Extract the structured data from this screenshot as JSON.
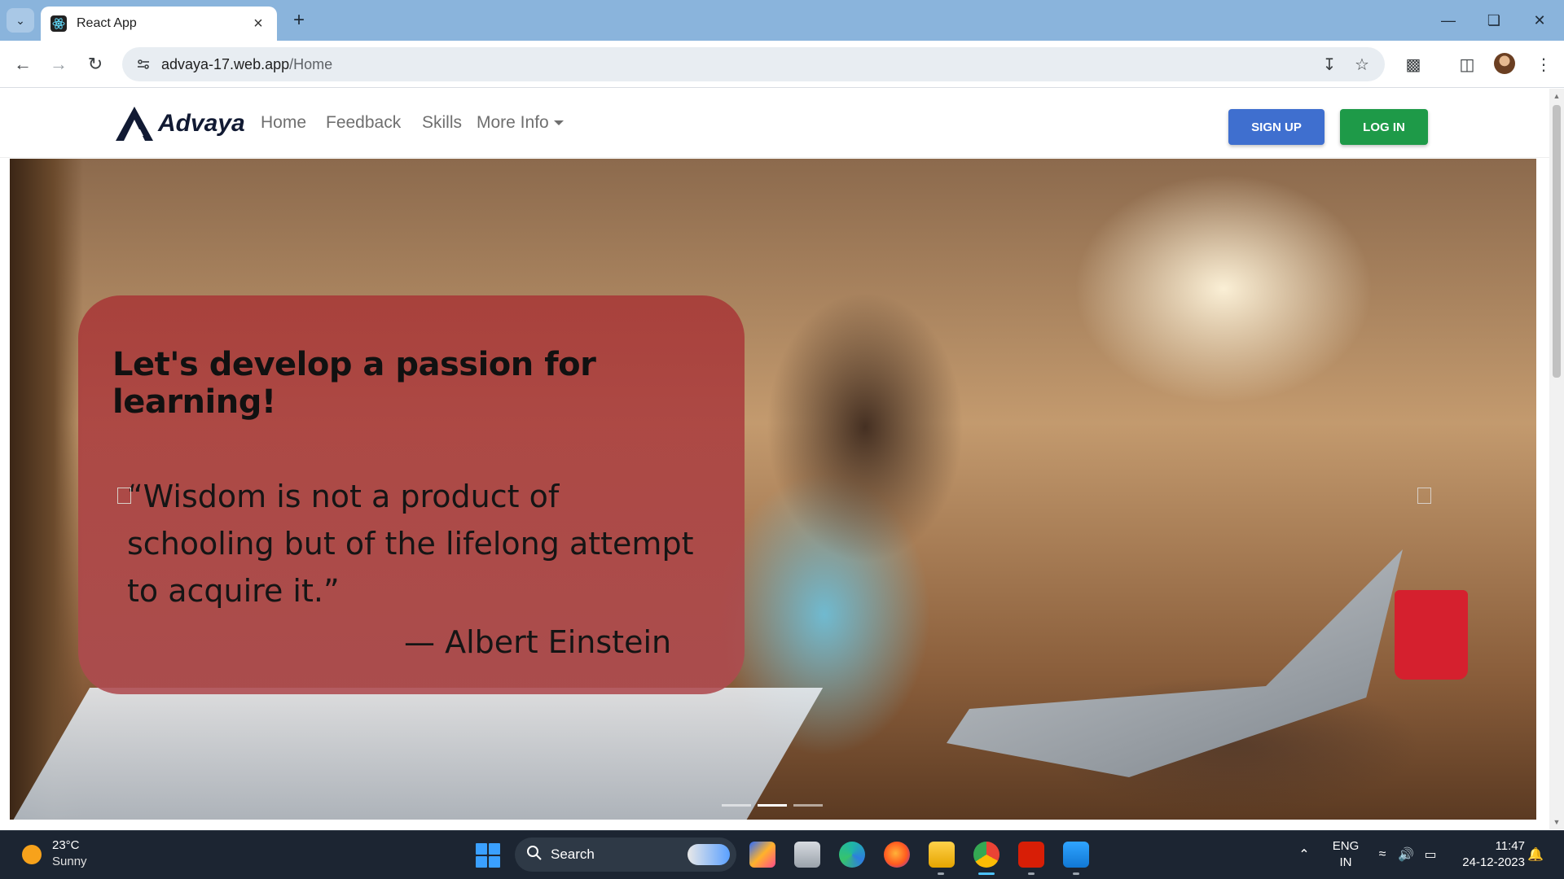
{
  "browser": {
    "tab_title": "React App",
    "url_domain": "advaya-17.web.app",
    "url_path": "/Home"
  },
  "site": {
    "brand": "Advaya",
    "nav": {
      "home": "Home",
      "feedback": "Feedback",
      "skills": "Skills",
      "more_info": "More Info"
    },
    "signup_label": "SIGN UP",
    "login_label": "LOG IN",
    "colors": {
      "signup": "#3f6fcf",
      "login": "#1e9a48",
      "card": "#a83a38"
    }
  },
  "hero": {
    "heading": "Let's develop a passion for learning!",
    "quote": "“Wisdom is not a product of schooling but of the lifelong attempt to acquire it.”",
    "author": "— Albert Einstein",
    "slide_count": 3,
    "active_slide": 2
  },
  "taskbar": {
    "weather_temp": "23°C",
    "weather_desc": "Sunny",
    "search_label": "Search",
    "lang_line1": "ENG",
    "lang_line2": "IN",
    "time": "11:47",
    "date": "24-12-2023"
  }
}
